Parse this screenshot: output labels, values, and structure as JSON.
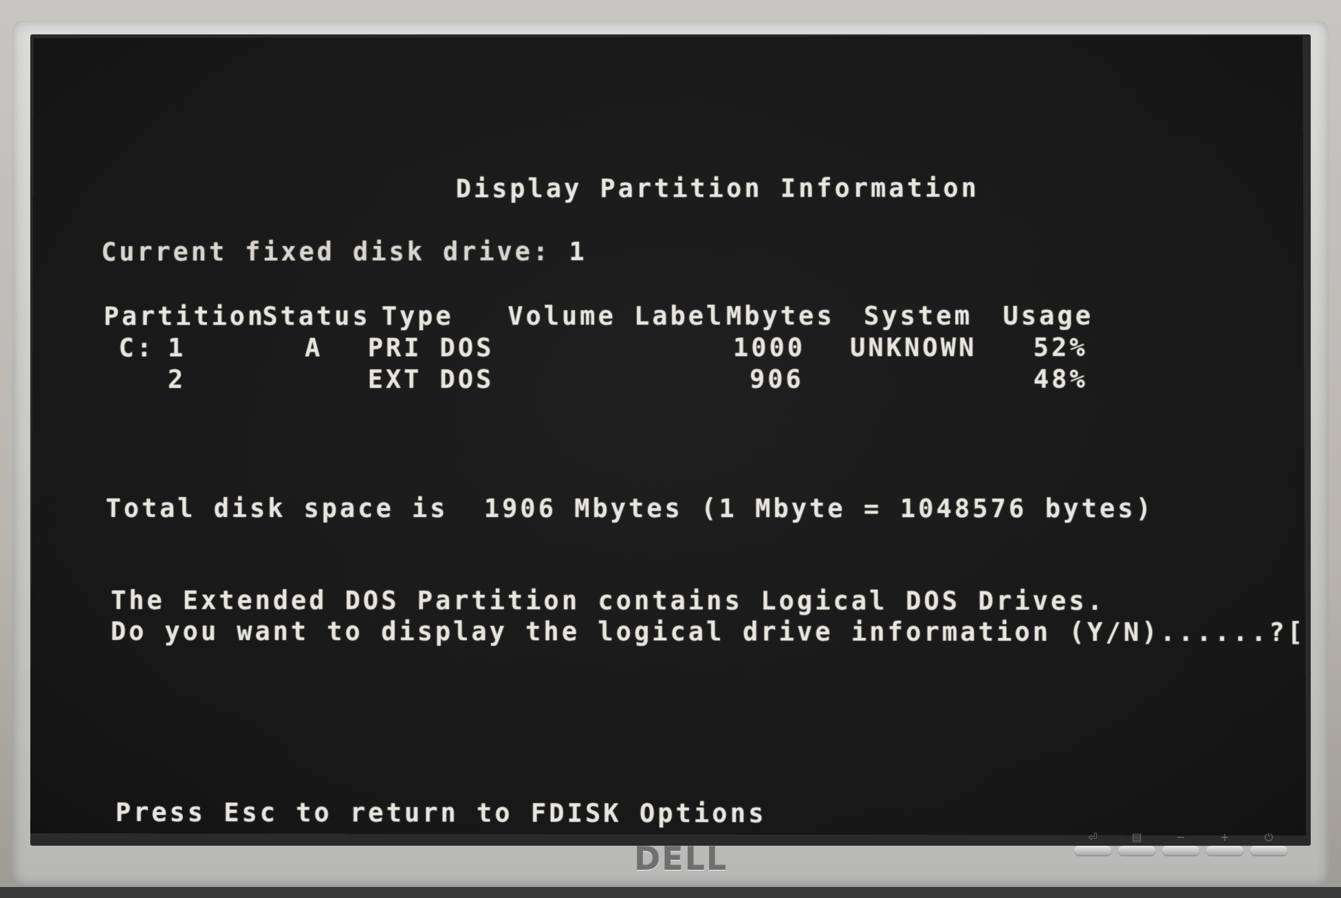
{
  "screen": {
    "title": "Display Partition Information",
    "current_drive_label": "Current fixed disk drive:",
    "current_drive_value": "1",
    "table": {
      "headers": [
        "Partition",
        "Status",
        "Type",
        "Volume Label",
        "Mbytes",
        "System",
        "Usage"
      ],
      "rows": [
        {
          "drive": "C:",
          "partition": "1",
          "status": "A",
          "type": "PRI DOS",
          "volume_label": "",
          "mbytes": "1000",
          "system": "UNKNOWN",
          "usage": "52%"
        },
        {
          "drive": "",
          "partition": "2",
          "status": "",
          "type": "EXT DOS",
          "volume_label": "",
          "mbytes": "906",
          "system": "",
          "usage": "48%"
        }
      ]
    },
    "total_prefix": "Total disk space is",
    "total_value": "1906",
    "total_suffix": "Mbytes (1 Mbyte = 1048576 bytes)",
    "message_line1": "The Extended DOS Partition contains Logical DOS Drives.",
    "message_line2": "Do you want to display the logical drive information (Y/N)......?",
    "prompt_answer": "[Y]",
    "esc_hint": "Press Esc to return to FDISK Options"
  },
  "monitor": {
    "brand": "DELL",
    "button_icons": [
      "input-source-icon",
      "menu-icon",
      "minus-icon",
      "plus-icon",
      "power-icon"
    ],
    "button_glyphs": [
      "⏎",
      "▤",
      "−",
      "+",
      "⏻"
    ]
  },
  "colors": {
    "screen_bg": "#181818",
    "text": "#e9e6df",
    "bezel": "#c9c9c7"
  }
}
